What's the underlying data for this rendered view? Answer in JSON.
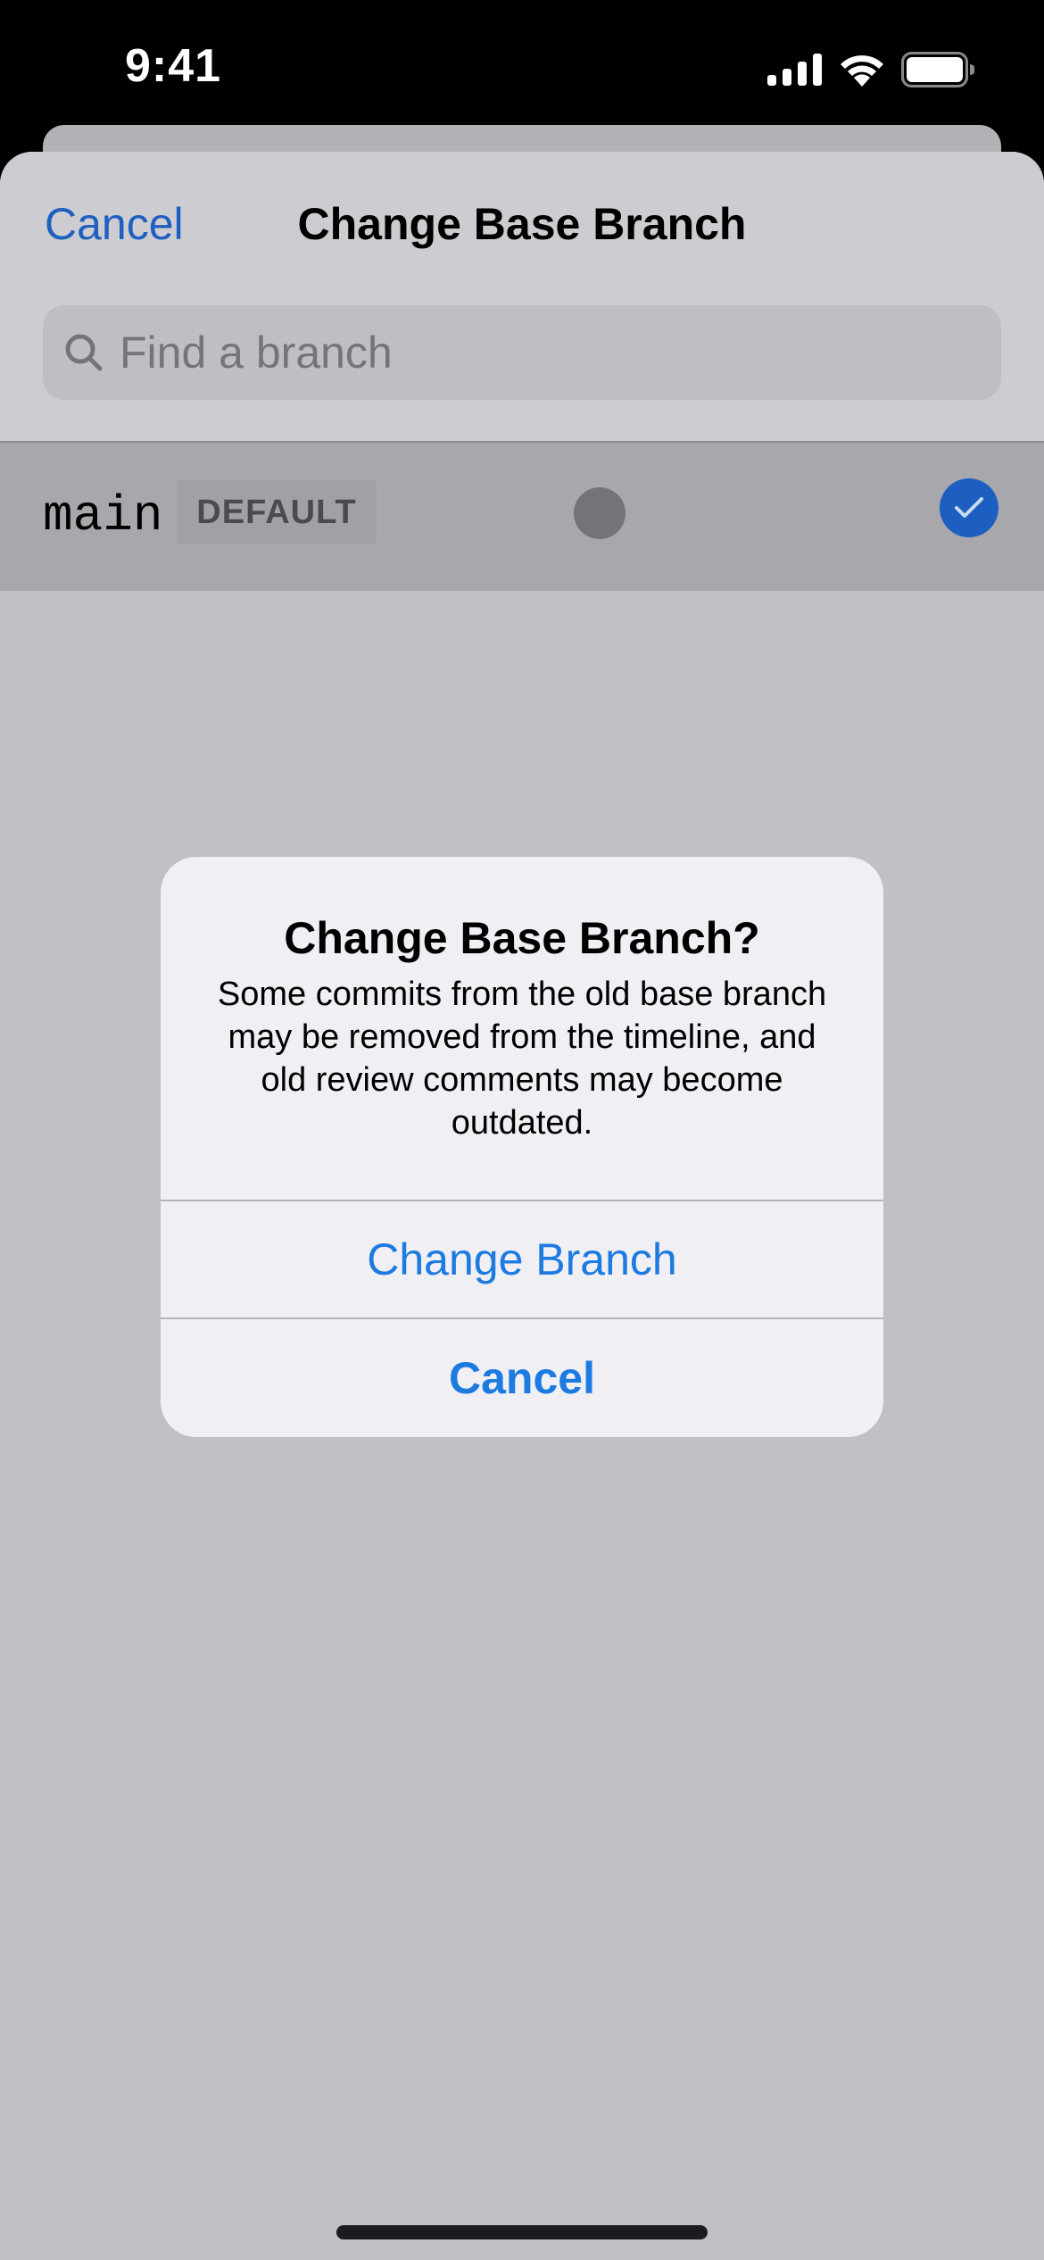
{
  "status_bar": {
    "time": "9:41",
    "icons": [
      "signal-icon",
      "wifi-icon",
      "battery-icon"
    ]
  },
  "sheet": {
    "nav": {
      "cancel_label": "Cancel",
      "title": "Change Base Branch"
    },
    "search": {
      "placeholder": "Find a branch",
      "value": "",
      "icon": "search-icon"
    },
    "branches": [
      {
        "name": "main",
        "badge": "DEFAULT",
        "selected": true,
        "icon": "checkmark-icon"
      }
    ]
  },
  "alert": {
    "title": "Change Base Branch?",
    "message": "Some commits from the old base branch may be removed from the timeline, and old review comments may become outdated.",
    "actions": {
      "confirm_label": "Change Branch",
      "cancel_label": "Cancel"
    }
  },
  "colors": {
    "accent": "#1c7ae0",
    "nav_link": "#1e5fbf",
    "check": "#1c5fc0"
  }
}
